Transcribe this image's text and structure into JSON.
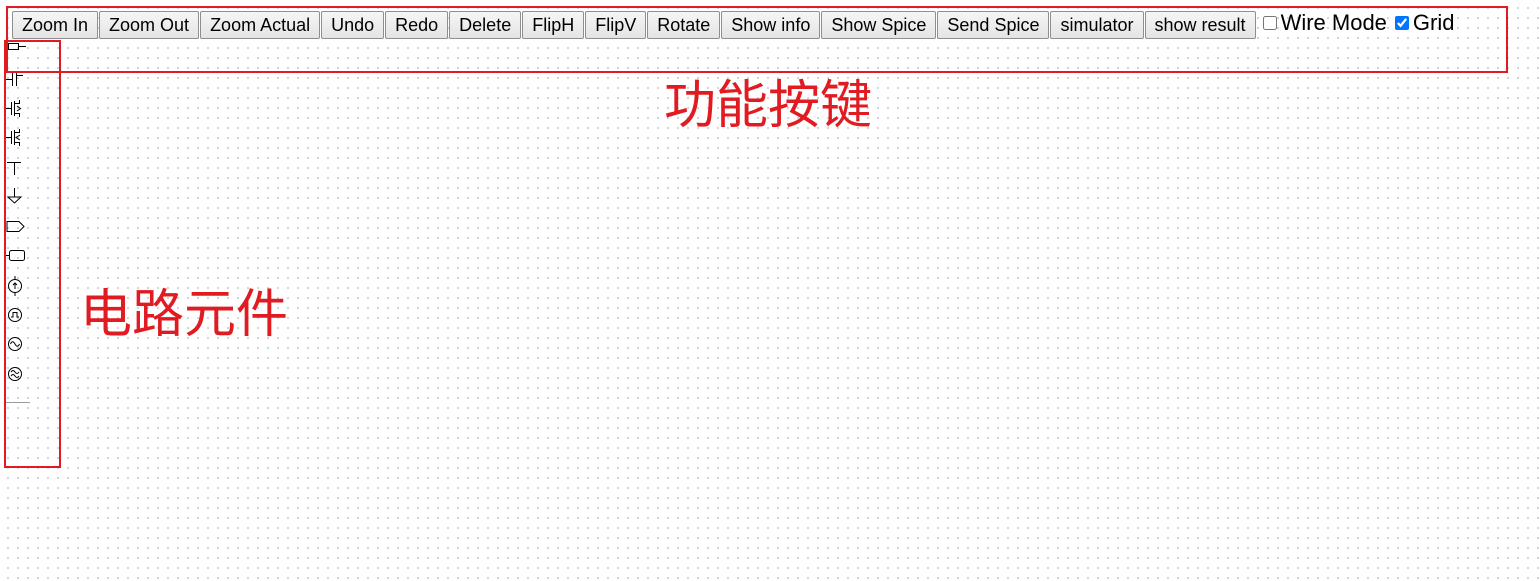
{
  "toolbar": {
    "zoom_in": "Zoom In",
    "zoom_out": "Zoom Out",
    "zoom_actual": "Zoom Actual",
    "undo": "Undo",
    "redo": "Redo",
    "delete": "Delete",
    "flip_h": "FlipH",
    "flip_v": "FlipV",
    "rotate": "Rotate",
    "show_info": "Show info",
    "show_spice": "Show Spice",
    "send_spice": "Send Spice",
    "simulator": "simulator",
    "show_result": "show result",
    "wire_mode_label": "Wire Mode",
    "wire_mode_checked": false,
    "grid_label": "Grid",
    "grid_checked": true
  },
  "annotations": {
    "toolbar_caption": "功能按键",
    "palette_caption": "电路元件",
    "color": "#e11b22"
  },
  "palette": {
    "items": [
      {
        "name": "resistor-icon"
      },
      {
        "name": "capacitor-icon"
      },
      {
        "name": "nmos-icon"
      },
      {
        "name": "pmos-icon"
      },
      {
        "name": "vdd-icon"
      },
      {
        "name": "ground-icon"
      },
      {
        "name": "output-port-icon"
      },
      {
        "name": "input-port-icon"
      },
      {
        "name": "dc-current-source-icon"
      },
      {
        "name": "pulse-source-icon"
      },
      {
        "name": "sine-source-icon"
      },
      {
        "name": "ac-source-icon"
      }
    ]
  }
}
